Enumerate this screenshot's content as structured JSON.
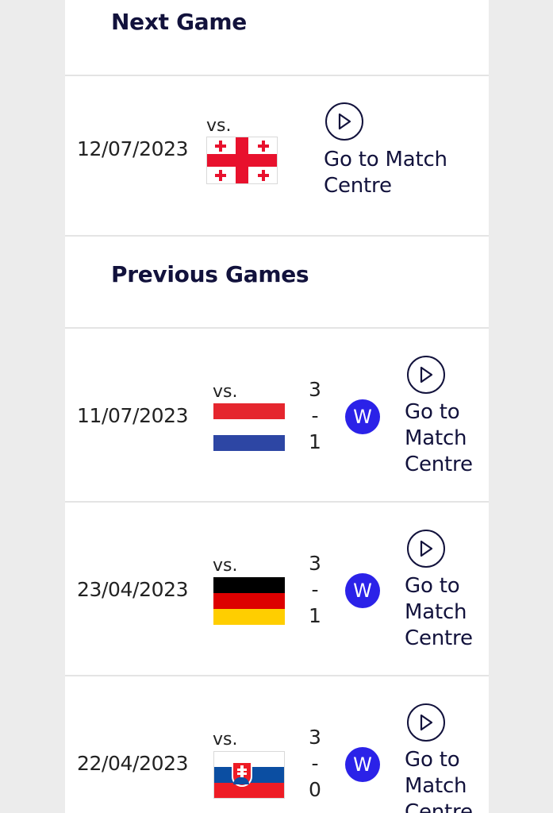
{
  "next_game": {
    "title": "Next Game",
    "match": {
      "date": "12/07/2023",
      "vs": "vs.",
      "opponent_flag": "georgia-flag",
      "link_line1": "Go to Match",
      "link_line2": "Centre"
    }
  },
  "previous_games": {
    "title": "Previous Games",
    "matches": [
      {
        "date": "11/07/2023",
        "vs": "vs.",
        "opponent_flag": "netherlands-flag",
        "score_home": "3",
        "score_sep": "-",
        "score_away": "1",
        "result": "W",
        "link_line1": "Go to",
        "link_line2": "Match",
        "link_line3": "Centre"
      },
      {
        "date": "23/04/2023",
        "vs": "vs.",
        "opponent_flag": "germany-flag",
        "score_home": "3",
        "score_sep": "-",
        "score_away": "1",
        "result": "W",
        "link_line1": "Go to",
        "link_line2": "Match",
        "link_line3": "Centre"
      },
      {
        "date": "22/04/2023",
        "vs": "vs.",
        "opponent_flag": "slovakia-flag",
        "score_home": "3",
        "score_sep": "-",
        "score_away": "0",
        "result": "W",
        "link_line1": "Go to",
        "link_line2": "Match",
        "link_line3": "Centre"
      }
    ]
  },
  "colors": {
    "win_badge": "#2b22e8",
    "title_text": "#12123c",
    "divider": "#e4e4e4",
    "page_background": "#ececec"
  }
}
